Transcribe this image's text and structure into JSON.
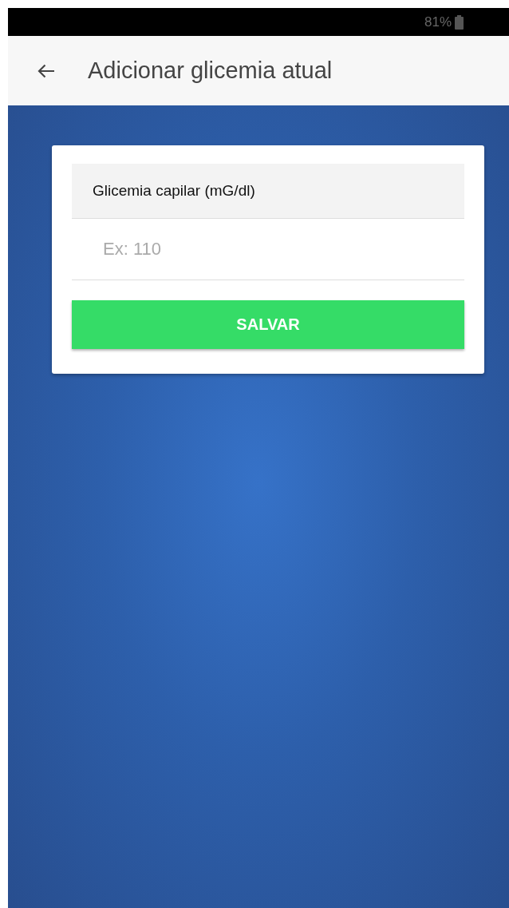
{
  "status_bar": {
    "battery": "81%"
  },
  "header": {
    "title": "Adicionar glicemia atual"
  },
  "form": {
    "label": "Glicemia capilar (mG/dl)",
    "placeholder": "Ex: 110",
    "button": "SALVAR"
  }
}
